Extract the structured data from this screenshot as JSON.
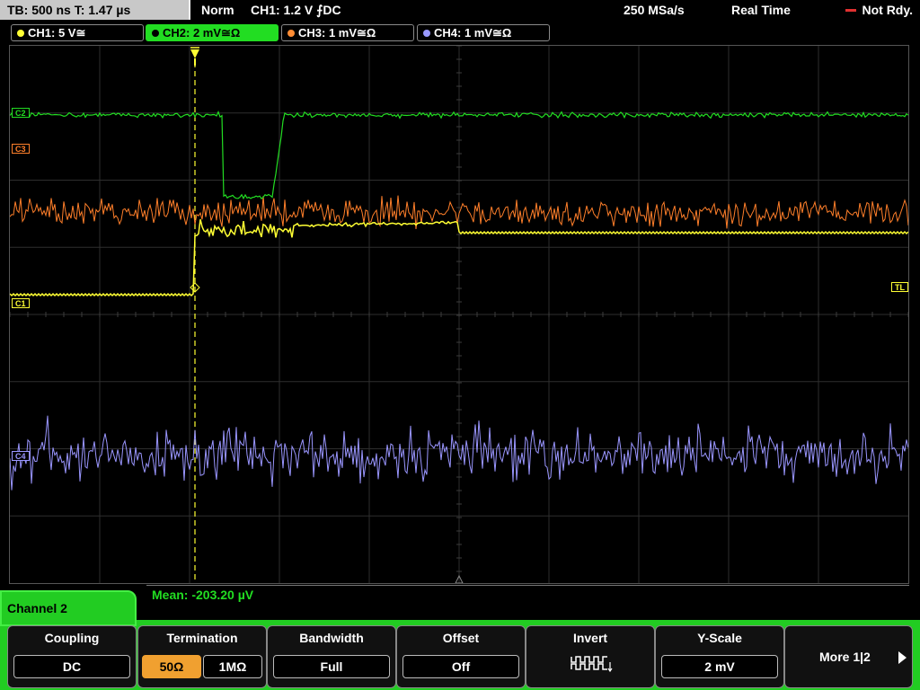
{
  "top_bar": {
    "timebase": "TB: 500 ns  T: 1.47 µs",
    "trigger_mode": "Norm",
    "trigger_info": "CH1: 1.2 V ⨍DC",
    "sample_rate": "250 MSa/s",
    "acq_mode": "Real Time",
    "status": "Not Rdy."
  },
  "channel_tabs": [
    {
      "label": "CH1: 5 V≅",
      "color": "#ffff33"
    },
    {
      "label": "CH2: 2 mV≅Ω",
      "color": "#22dd22",
      "active": true
    },
    {
      "label": "CH3: 1 mV≅Ω",
      "color": "#ff8c33"
    },
    {
      "label": "CH4: 1 mV≅Ω",
      "color": "#9999ff"
    }
  ],
  "markers": {
    "c2": "C2",
    "c3": "C3",
    "c1": "C1",
    "tl": "TL",
    "c4": "C4"
  },
  "colors": {
    "ch1": "#ffff33",
    "ch2": "#22dd22",
    "ch3": "#ff7f2a",
    "ch4": "#9a96ff",
    "trigger": "#ffff33",
    "panel": "#22cc22",
    "option_selected": "#f0a030"
  },
  "measurement": {
    "text": "Mean: -203.20 µV"
  },
  "panel": {
    "title": "Channel 2",
    "keys": {
      "coupling": {
        "title": "Coupling",
        "value": "DC"
      },
      "termination": {
        "title": "Termination",
        "option_a": "50Ω",
        "option_b": "1MΩ",
        "selected": "50Ω"
      },
      "bandwidth": {
        "title": "Bandwidth",
        "value": "Full"
      },
      "offset": {
        "title": "Offset",
        "value": "Off"
      },
      "invert": {
        "title": "Invert",
        "icon": "invert-waveform-icon"
      },
      "yscale": {
        "title": "Y-Scale",
        "value": "2 mV"
      },
      "more": {
        "label": "More 1|2"
      }
    }
  }
}
